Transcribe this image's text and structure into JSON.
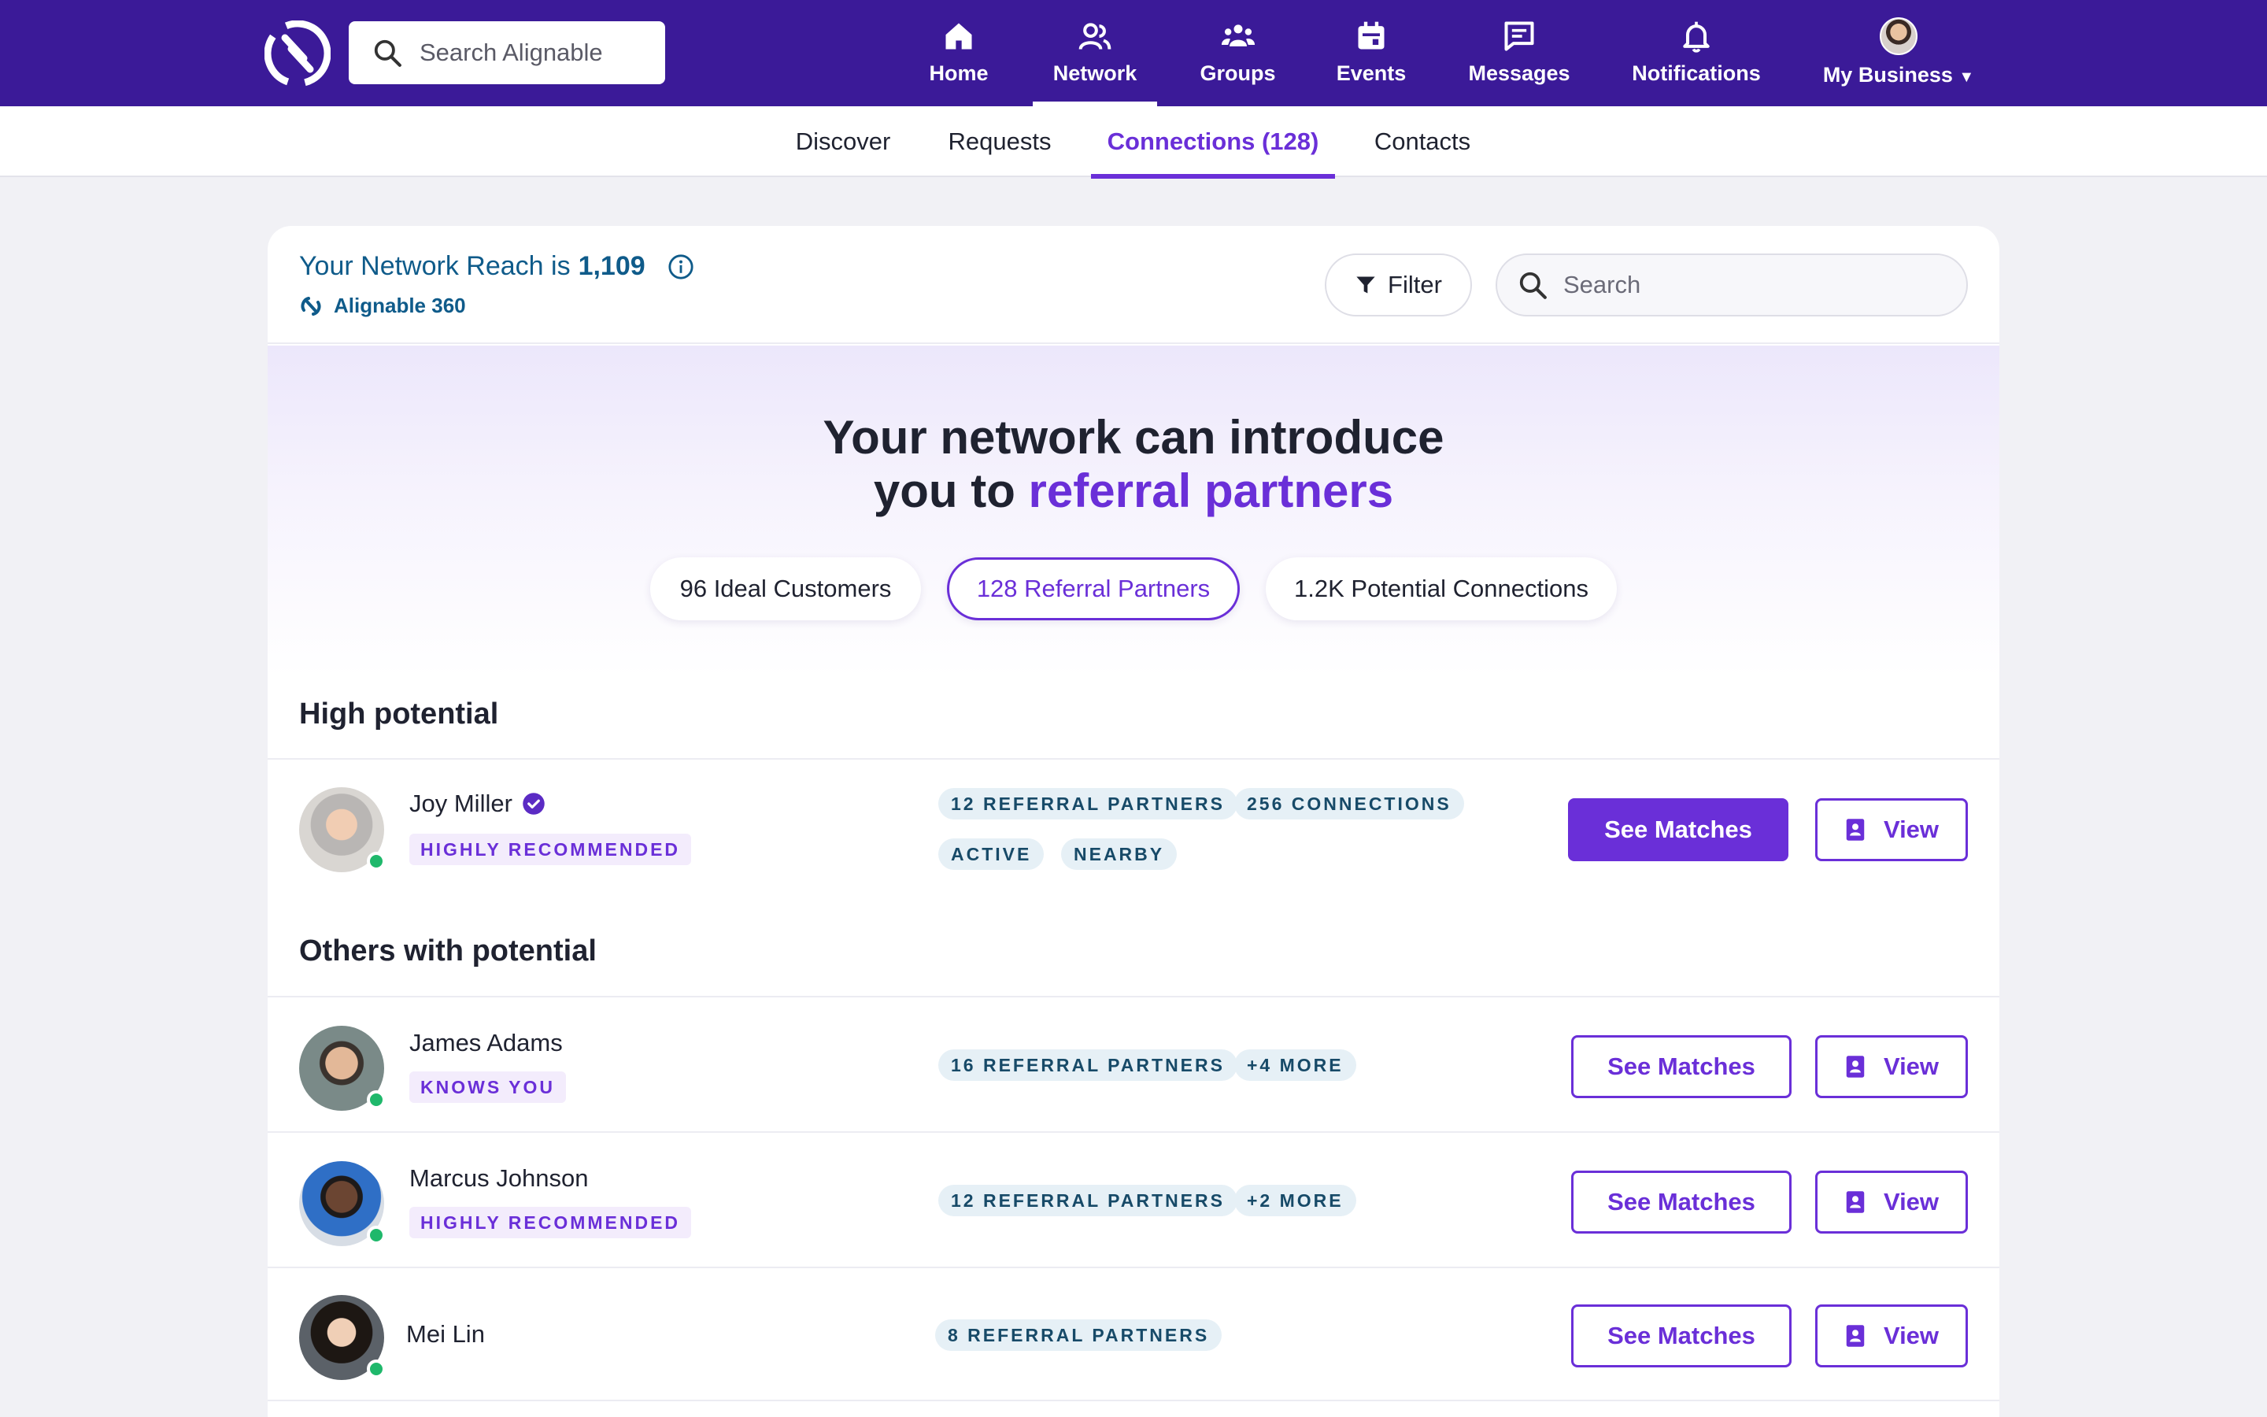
{
  "topnav": {
    "search_placeholder": "Search Alignable",
    "items": [
      {
        "label": "Home",
        "icon": "home-icon"
      },
      {
        "label": "Network",
        "icon": "network-icon"
      },
      {
        "label": "Groups",
        "icon": "groups-icon"
      },
      {
        "label": "Events",
        "icon": "calendar-icon"
      },
      {
        "label": "Messages",
        "icon": "messages-icon"
      },
      {
        "label": "Notifications",
        "icon": "bell-icon"
      },
      {
        "label": "My Business",
        "icon": "avatar"
      }
    ],
    "active": "Network",
    "colors": {
      "bar": "#3b1a98",
      "accent": "#6a2fd8"
    }
  },
  "subnav": {
    "tabs": [
      {
        "label": "Discover"
      },
      {
        "label": "Requests"
      },
      {
        "label": "Connections (128)"
      },
      {
        "label": "Contacts"
      }
    ],
    "active": "Connections (128)"
  },
  "card": {
    "reach_prefix": "Your Network Reach is",
    "reach_value": "1,109",
    "brand_label": "Alignable 360",
    "filter_label": "Filter",
    "search_placeholder": "Search",
    "hero_line1": "Your network can introduce",
    "hero_line2_prefix": "you to",
    "hero_line2_accent": "referral partners",
    "pills": [
      {
        "label": "96 Ideal Customers"
      },
      {
        "label": "128 Referral Partners"
      },
      {
        "label": "1.2K Potential Connections"
      }
    ],
    "active_pill": "128 Referral Partners"
  },
  "sections": {
    "high": "High potential",
    "others": "Others with potential"
  },
  "people": [
    {
      "name": "Joy Miller",
      "verified": true,
      "badge": "HIGHLY RECOMMENDED",
      "chips": [
        "12 REFERRAL PARTNERS",
        "256 CONNECTIONS",
        "ACTIVE",
        "NEARBY"
      ],
      "matches_label": "See Matches",
      "view_label": "View",
      "online": true
    },
    {
      "name": "James Adams",
      "badge": "KNOWS YOU",
      "chips": [
        "16 REFERRAL PARTNERS",
        "+4 MORE"
      ],
      "matches_label": "See Matches",
      "view_label": "View",
      "online": true
    },
    {
      "name": "Marcus Johnson",
      "badge": "HIGHLY RECOMMENDED",
      "chips": [
        "12 REFERRAL PARTNERS",
        "+2 MORE"
      ],
      "matches_label": "See Matches",
      "view_label": "View",
      "online": true
    },
    {
      "name": "Mei Lin",
      "chips": [
        "8 REFERRAL PARTNERS"
      ],
      "matches_label": "See Matches",
      "view_label": "View",
      "online": true
    }
  ]
}
